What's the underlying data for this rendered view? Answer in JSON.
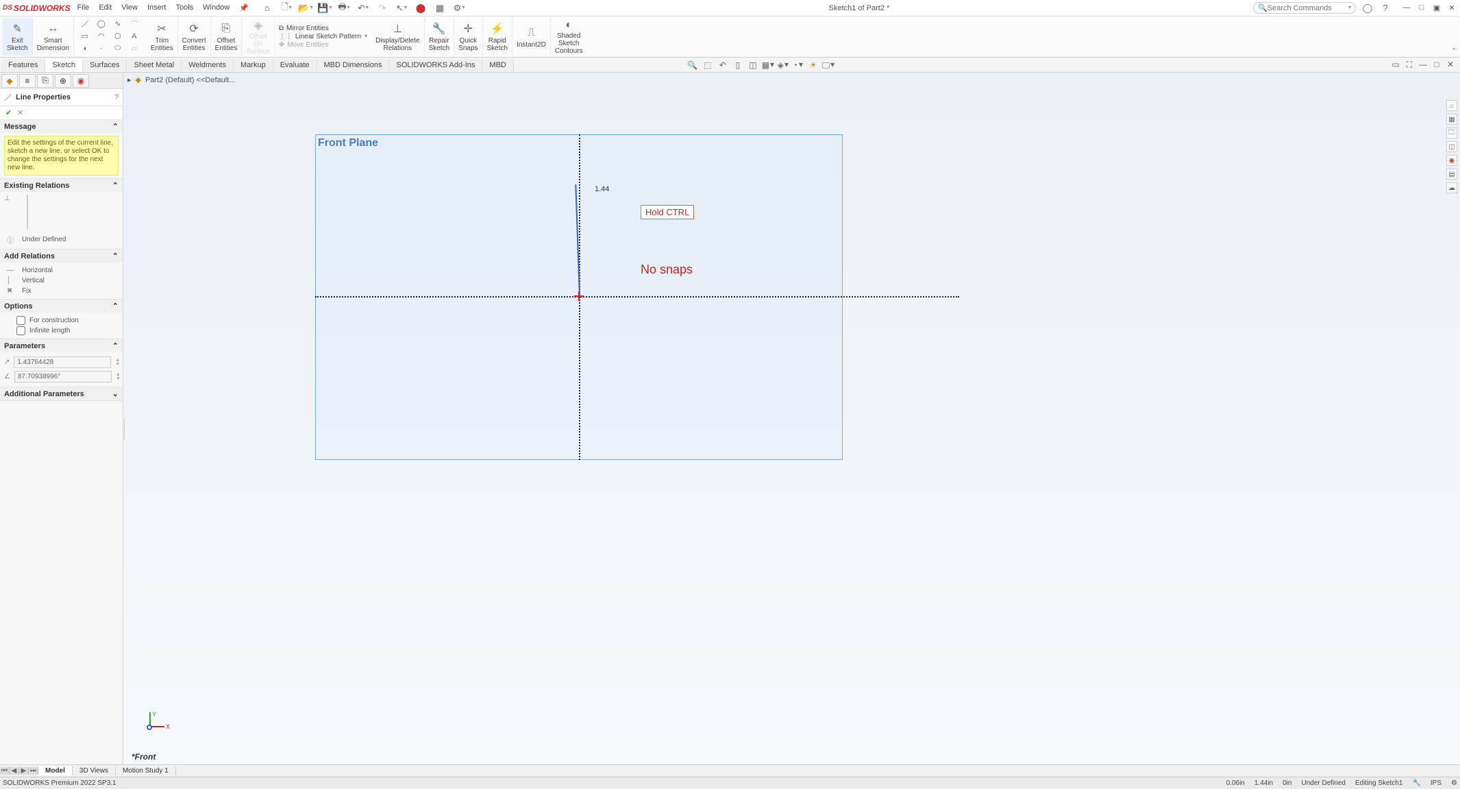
{
  "app": {
    "logo_prefix": "DS",
    "logo_name": "SOLIDWORKS"
  },
  "menu": [
    "File",
    "Edit",
    "View",
    "Insert",
    "Tools",
    "Window"
  ],
  "doc_title": "Sketch1 of Part2 *",
  "search_placeholder": "Search Commands",
  "ribbon": {
    "exit_sketch": "Exit\nSketch",
    "smart_dim": "Smart\nDimension",
    "trim": "Trim\nEntities",
    "convert": "Convert\nEntities",
    "offset": "Offset\nEntities",
    "offset_surface": "Offset\nOn\nSurface",
    "mirror": "Mirror Entities",
    "linear": "Linear Sketch Pattern",
    "move": "Move Entities",
    "display_delete": "Display/Delete\nRelations",
    "repair": "Repair\nSketch",
    "quick_snaps": "Quick\nSnaps",
    "rapid": "Rapid\nSketch",
    "instant2d": "Instant2D",
    "shaded": "Shaded\nSketch\nContours"
  },
  "cmd_tabs": [
    "Features",
    "Sketch",
    "Surfaces",
    "Sheet Metal",
    "Weldments",
    "Markup",
    "Evaluate",
    "MBD Dimensions",
    "SOLIDWORKS Add-Ins",
    "MBD"
  ],
  "active_cmd_tab": "Sketch",
  "breadcrumb": "Part2 (Default) <<Default...",
  "pm": {
    "title": "Line Properties",
    "message_head": "Message",
    "message_body": "Edit the settings of the current line, sketch a new line, or select OK to change the settings for the next new line.",
    "existing_head": "Existing Relations",
    "under_defined": "Under Defined",
    "add_head": "Add Relations",
    "rel_h": "Horizontal",
    "rel_v": "Vertical",
    "rel_fix": "Fix",
    "options_head": "Options",
    "opt_construction": "For construction",
    "opt_infinite": "Infinite length",
    "params_head": "Parameters",
    "param_len": "1.43764428",
    "param_ang": "87.70938996°",
    "additional_head": "Additional Parameters"
  },
  "viewport": {
    "plane": "Front Plane",
    "dim": "1.44",
    "anno1": "Hold CTRL",
    "anno2": "No snaps",
    "viewname": "*Front"
  },
  "bottom_tabs": [
    "Model",
    "3D Views",
    "Motion Study 1"
  ],
  "status": {
    "product": "SOLIDWORKS Premium 2022 SP3.1",
    "v1": "0.06in",
    "v2": "1.44in",
    "v3": "0in",
    "defined": "Under Defined",
    "editing": "Editing Sketch1",
    "units": "IPS"
  }
}
